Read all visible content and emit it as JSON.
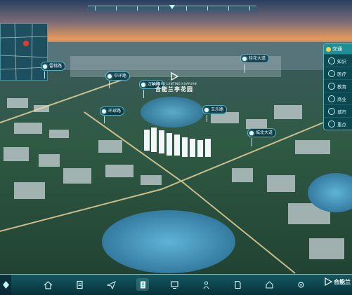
{
  "project": {
    "name_en": "BEDONG LANTING HUAYUAN",
    "name_cn": "合能兰亭花园"
  },
  "map_labels": [
    {
      "name": "label-1",
      "text": "雷桃路"
    },
    {
      "name": "label-2",
      "text": "中环路"
    },
    {
      "name": "label-3",
      "text": "汉纳路"
    },
    {
      "name": "label-4",
      "text": "环球路"
    },
    {
      "name": "label-5",
      "text": "桂花大道"
    },
    {
      "name": "label-6",
      "text": "玉乐路"
    },
    {
      "name": "label-7",
      "text": "城北大道"
    }
  ],
  "side_menu": {
    "header": "交通",
    "items": [
      "知识",
      "医疗",
      "教育",
      "商业",
      "城市",
      "重点"
    ]
  },
  "toolbar": {
    "brand": "合能兰",
    "icons": [
      "home-icon",
      "document-icon",
      "send-icon",
      "building-icon",
      "monitor-icon",
      "person-icon",
      "file-icon",
      "house-icon",
      "settings-icon"
    ]
  },
  "colors": {
    "accent": "#1e8f94",
    "panel": "#0a4650",
    "highlight": "#e7fbff"
  }
}
